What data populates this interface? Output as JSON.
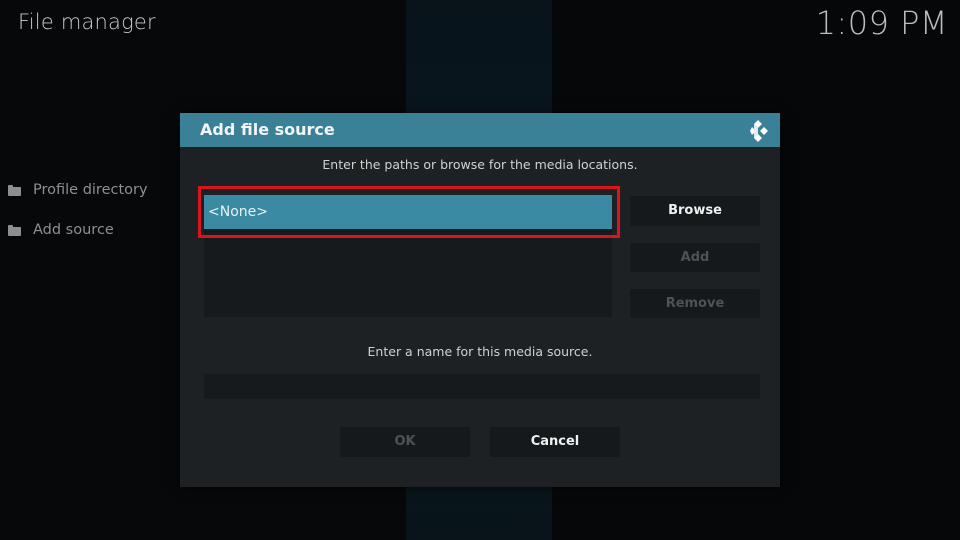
{
  "header": {
    "title": "File manager",
    "clock": "1:09 PM"
  },
  "sidebar": {
    "items": [
      {
        "label": "Profile directory",
        "icon": "folder-icon"
      },
      {
        "label": "Add source",
        "icon": "folder-icon"
      }
    ]
  },
  "dialog": {
    "title": "Add file source",
    "logo_icon": "kodi-logo-icon",
    "paths_instruction": "Enter the paths or browse for the media locations.",
    "paths": [
      {
        "value": "<None>",
        "selected": true
      }
    ],
    "buttons": {
      "browse": "Browse",
      "add": "Add",
      "remove": "Remove",
      "ok": "OK",
      "cancel": "Cancel"
    },
    "name_instruction": "Enter a name for this media source.",
    "name_value": "",
    "colors": {
      "header": "#3a8198",
      "selected_item": "#3b8aa3",
      "highlight_border": "#d9141d"
    }
  }
}
